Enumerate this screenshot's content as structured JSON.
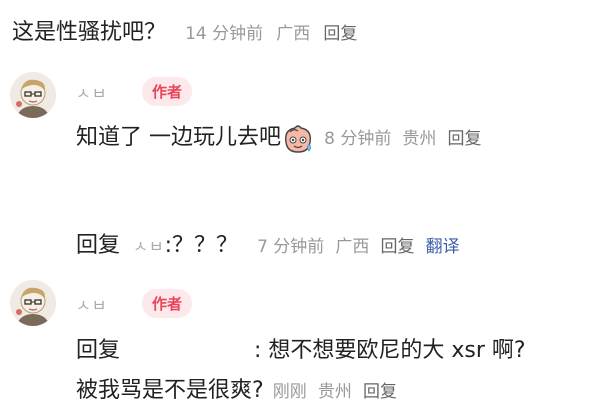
{
  "comment1": {
    "text": "这是性骚扰吧？",
    "time": "14 分钟前",
    "location": "广西",
    "reply_label": "回复"
  },
  "comment2": {
    "username": "ㅅㅂ",
    "badge": "作者",
    "text": "知道了 一边玩儿去吧",
    "emoji_icon": "sweat-smile-peach-icon",
    "time": "8 分钟前",
    "location": "贵州",
    "reply_label": "回复"
  },
  "reply1": {
    "prefix": "回复",
    "target_user": "ㅅㅂ",
    "text": ":？？？",
    "time": "7 分钟前",
    "location": "广西",
    "reply_label": "回复",
    "translate_label": "翻译"
  },
  "comment3": {
    "username": "ㅅㅂ",
    "badge": "作者",
    "prefix": "回复",
    "text_line1": ": 想不想要欧尼的大 xsr 啊?",
    "text_line2": "被我骂是不是很爽?",
    "time": "刚刚",
    "location": "贵州",
    "reply_label": "回复"
  },
  "colors": {
    "badge_bg": "#fde9ec",
    "badge_text": "#e8445a",
    "translate": "#3a5ea8",
    "meta": "#999999"
  }
}
